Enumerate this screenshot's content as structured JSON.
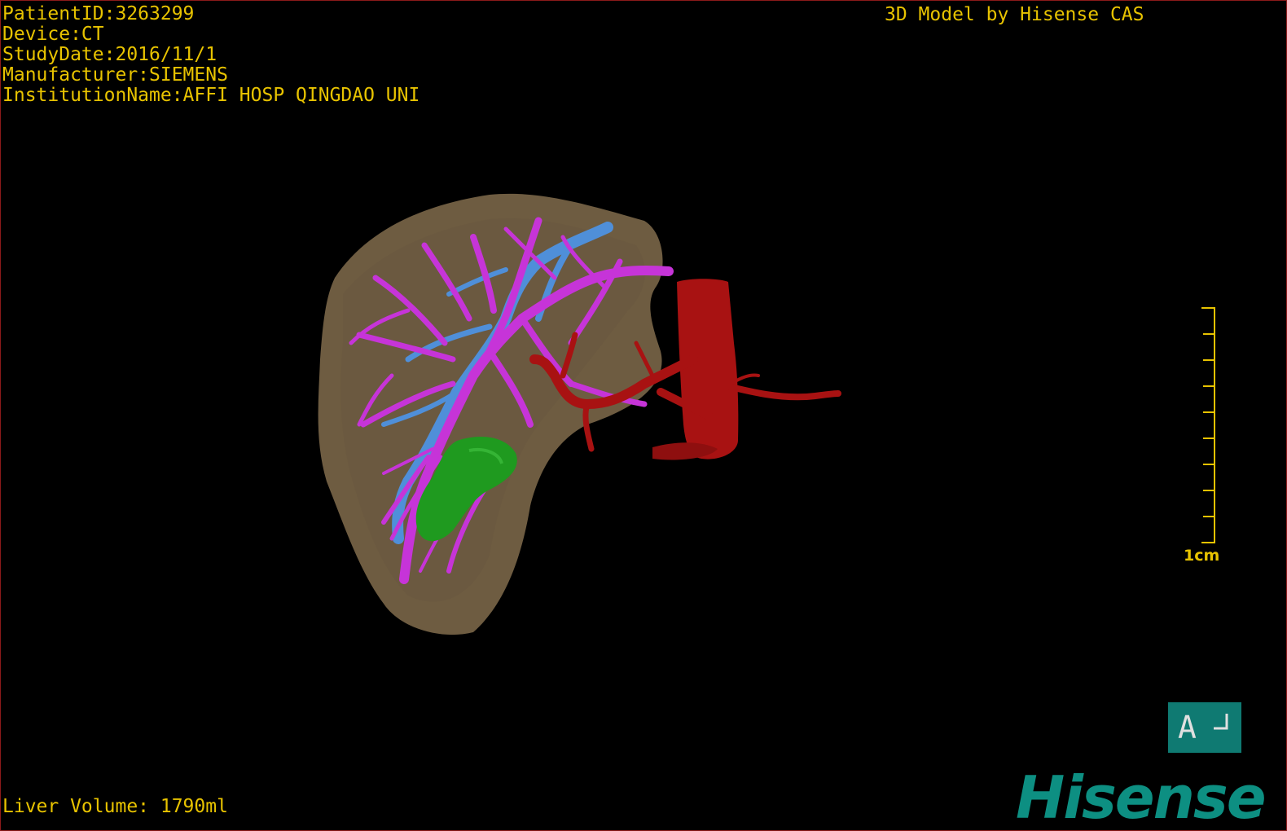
{
  "patient_info": {
    "patient_id": "PatientID:3263299",
    "device": "Device:CT",
    "study_date": "StudyDate:2016/11/1",
    "manufacturer": "Manufacturer:SIEMENS",
    "institution": "InstitutionName:AFFI HOSP QINGDAO UNI"
  },
  "credit": "3D Model by Hisense CAS",
  "liver_volume": "Liver Volume: 1790ml",
  "scale_bar": {
    "label": "1cm",
    "color": "#e8c300"
  },
  "orientation": {
    "label": "A",
    "color": "#0f7a72"
  },
  "brand": "Hisense",
  "colors": {
    "background": "#000000",
    "overlay_text": "#e8c300",
    "liver": "#7a6648",
    "bile_ducts": "#c634d8",
    "portal_vein": "#4f8fd9",
    "arteries": "#a81212",
    "gallbladder": "#1f9a1f",
    "brand": "#0d8f82"
  }
}
